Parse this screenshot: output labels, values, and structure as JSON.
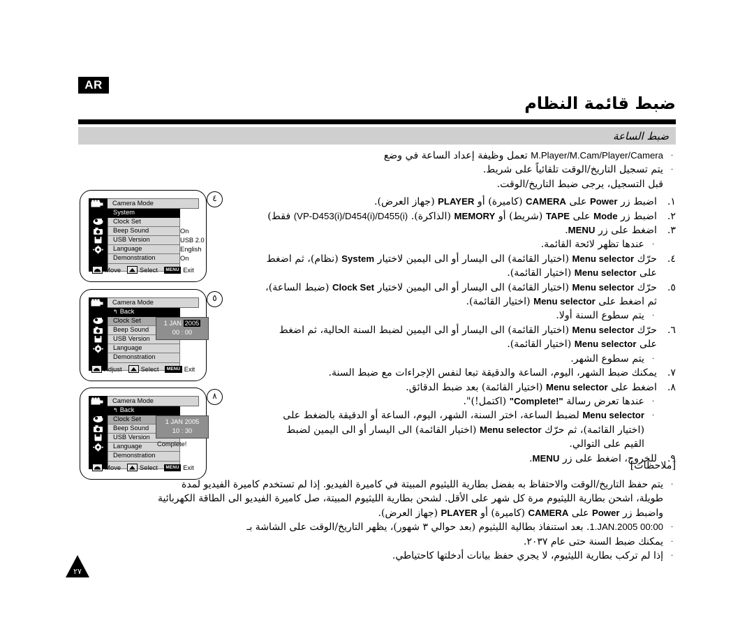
{
  "header": {
    "lang_badge": "AR",
    "title": "ضبط قائمة النظام",
    "section": "ضبط الساعة"
  },
  "intro": {
    "bullet_mark": "٠",
    "b1": "تعمل وظيفة إعداد الساعة في وضع",
    "b1_lat": "M.Player/M.Cam/Player/Camera",
    "b1_end": ".",
    "b2": "يتم تسجيل التاريخ/الوقت تلقائياً على شريط.",
    "b2_cont": "قبل التسجيل، يرجى ضبط التاريخ/الوقت."
  },
  "steps": [
    {
      "num": "١.",
      "parts": [
        "اضبط زر",
        "Power",
        "على",
        "CAMERA",
        "(كاميرة) أو",
        "PLAYER",
        "(جهاز العرض)."
      ]
    },
    {
      "num": "٢.",
      "parts": [
        "اضبط زر",
        "Mode",
        "على",
        "TAPE",
        "(شريط) أو",
        "MEMORY",
        "(الذاكرة).",
        "(VP-D453(i)/D454(i)/D455(i)",
        "فقط)"
      ]
    },
    {
      "num": "٣.",
      "parts": [
        "اضغط على زر",
        "MENU",
        "."
      ]
    }
  ],
  "sub_notes": {
    "s3": "عندها تظهر لائحة القائمة.",
    "s5": "يتم سطوع السنة أولا.",
    "s6": "يتم سطوع الشهر.",
    "s8a_pre": "عندها تعرض رسالة",
    "s8a_lat": "\"Complete!\"",
    "s8a_post": "(اكتمل!)\"."
  },
  "step4": {
    "num": "٤.",
    "line1_a": "حرّك",
    "line1_lat": "Menu selector",
    "line1_b": "(اختيار القائمة) الى اليسار أو الى اليمين لاختيار",
    "line1_lat2": "System",
    "line1_c": "(نظام)، ثم اضغط",
    "line2_a": "على",
    "line2_lat": "Menu selector",
    "line2_b": "(اختيار القائمة)."
  },
  "step5": {
    "num": "٥.",
    "line1_a": "حرّك",
    "line1_lat": "Menu selector",
    "line1_b": "(اختيار القائمة) الى اليسار أو الى اليمين لاختيار",
    "line1_lat2": "Clock Set",
    "line1_c": "(ضبط الساعة)،",
    "line2_a": "ثم اضغط على",
    "line2_lat": "Menu selector",
    "line2_b": "(اختيار القائمة)."
  },
  "step6": {
    "num": "٦.",
    "line1_a": "حرّك",
    "line1_lat": "Menu selector",
    "line1_b": "(اختيار القائمة) الى اليسار أو الى اليمين لضبط السنة الحالية، ثم اضغط",
    "line2_a": "على",
    "line2_lat": "Menu selector",
    "line2_b": "(اختيار القائمة)."
  },
  "step7": {
    "num": "٧.",
    "text": "يمكنك ضبط الشهر، اليوم، الساعة والدقيقة تبعا لنفس الإجراءات مع ضبط السنة."
  },
  "step8": {
    "num": "٨.",
    "line_a": "اضغط على",
    "line_lat": "Menu selector",
    "line_b": "(اختيار القائمة) بعد ضبط الدقائق."
  },
  "step8_detail": {
    "line1_a": "لضبط الساعة، اختر السنة، الشهر، اليوم، الساعة أو الدقيقة بالضغط على",
    "line1_lat": "Menu selector",
    "line2_a": "(اختيار القائمة)، ثم حرّك",
    "line2_lat": "Menu selector",
    "line2_b": "(اختيار القائمة) الى اليسار أو الى اليمين لضبط",
    "line3": "القيم على التوالي."
  },
  "step9": {
    "num": "٩.",
    "line_a": "للخروج، اضغط على زر",
    "line_lat": "MENU",
    "line_b": "."
  },
  "lcds": [
    {
      "circle": "٤",
      "mode_label": "Camera Mode",
      "rows": [
        {
          "label": "System",
          "value": "",
          "state": "sel-black"
        },
        {
          "label": "Clock Set",
          "value": "",
          "state": ""
        },
        {
          "label": "Beep Sound",
          "value": "On",
          "state": ""
        },
        {
          "label": "USB Version",
          "value": "USB 2.0",
          "state": ""
        },
        {
          "label": "Language",
          "value": "English",
          "state": ""
        },
        {
          "label": "Demonstration",
          "value": "On",
          "state": ""
        }
      ],
      "clock": null,
      "complete": "",
      "guide": {
        "move": "Move",
        "select": "Select",
        "menu": "MENU",
        "exit": "Exit"
      }
    },
    {
      "circle": "٥",
      "mode_label": "Camera Mode",
      "rows": [
        {
          "label": "Back",
          "value": "",
          "state": "sel-black",
          "back": true
        },
        {
          "label": "Clock Set",
          "value": "",
          "state": "sel-gray"
        },
        {
          "label": "Beep Sound",
          "value": "",
          "state": ""
        },
        {
          "label": "USB Version",
          "value": "",
          "state": ""
        },
        {
          "label": "Language",
          "value": "",
          "state": ""
        },
        {
          "label": "Demonstration",
          "value": "",
          "state": ""
        }
      ],
      "clock": {
        "day": "1",
        "month": "JAN",
        "year": "2005",
        "year_highlight": true,
        "time": "00 : 00"
      },
      "complete": "",
      "guide": {
        "move": "Adjust",
        "select": "Select",
        "menu": "MENU",
        "exit": "Exit"
      }
    },
    {
      "circle": "٨",
      "mode_label": "Camera Mode",
      "rows": [
        {
          "label": "Back",
          "value": "",
          "state": "sel-black",
          "back": true
        },
        {
          "label": "Clock Set",
          "value": "",
          "state": "sel-gray"
        },
        {
          "label": "Beep Sound",
          "value": "",
          "state": ""
        },
        {
          "label": "USB Version",
          "value": "",
          "state": ""
        },
        {
          "label": "Language",
          "value": "",
          "state": ""
        },
        {
          "label": "Demonstration",
          "value": "",
          "state": ""
        }
      ],
      "clock": {
        "day": "1",
        "month": "JAN",
        "year": "2005",
        "year_highlight": false,
        "time": "10 : 30"
      },
      "complete": "Complete!",
      "guide": {
        "move": "Move",
        "select": "Select",
        "menu": "MENU",
        "exit": "Exit"
      }
    }
  ],
  "notes": {
    "heading": "[ملاحظات]",
    "bullet_mark": "٠",
    "n1_l1": "يتم حفظ التاريخ/الوقت والاحتفاظ به بفضل بطارية الليثيوم المبيتة في كاميرة الفيديو. إذا لم تستخدم كاميرة الفيديو لمدة",
    "n1_l2": "طويلة، اشحن بطارية الليثيوم مرة كل شهر على الأقل. لشحن بطارية الليثيوم المبيتة، صل كاميرة الفيديو الى الطاقة الكهربائية",
    "n1_l3_a": "واضبط زر",
    "n1_l3_lat1": "Power",
    "n1_l3_b": "على",
    "n1_l3_lat2": "CAMERA",
    "n1_l3_c": "(كاميرة) أو",
    "n1_l3_lat3": "PLAYER",
    "n1_l3_d": "(جهاز العرض).",
    "n2_a": "بعد استنفاذ بطالية الليثيوم (بعد حوالي ٣ شهور)، يظهر التاريخ/الوقت على الشاشة بـ",
    "n2_lat": "1.JAN.2005 00:00",
    "n2_b": ".",
    "n3": "يمكنك ضبط السنة حتى عام ٢٠٣٧.",
    "n4": "إذا لم تركب بطارية الليثيوم، لا يجري حفظ بيانات أدخلتها كاحتياطي."
  },
  "page_number": "٢٧"
}
